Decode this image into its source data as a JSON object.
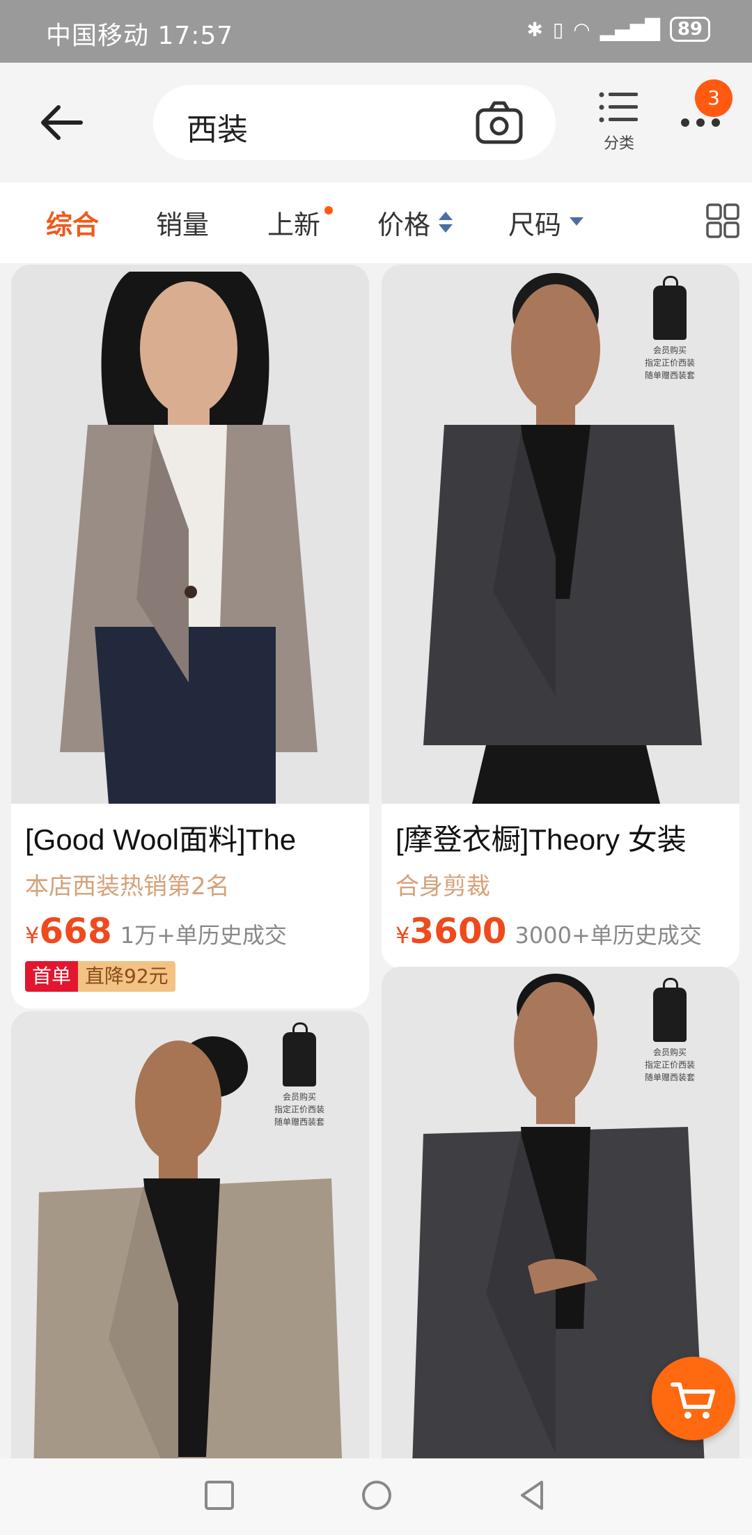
{
  "status_bar": {
    "carrier": "中国移动",
    "time": "17:57",
    "battery": "89"
  },
  "header": {
    "search_query": "西装",
    "category_label": "分类",
    "cart_badge": "3"
  },
  "sort_tabs": [
    {
      "label": "综合",
      "active": true
    },
    {
      "label": "销量"
    },
    {
      "label": "上新"
    },
    {
      "label": "价格"
    },
    {
      "label": "尺码"
    }
  ],
  "products": [
    {
      "title": "[Good Wool面料]The",
      "tag": "本店西装热销第2名",
      "currency": "¥",
      "price": "668",
      "sales": "1万+单历史成交",
      "promo_left": "首单",
      "promo_right": "直降92元"
    },
    {
      "title": "[摩登衣橱]Theory 女装",
      "tag": "合身剪裁",
      "currency": "¥",
      "price": "3600",
      "sales": "3000+单历史成交",
      "stamp": [
        "会员购买",
        "指定正价西装",
        "随单赠西装套"
      ]
    },
    {
      "stamp": [
        "会员购买",
        "指定正价西装",
        "随单赠西装套"
      ]
    },
    {
      "stamp": [
        "会员购买",
        "指定正价西装",
        "随单赠西装套"
      ]
    }
  ],
  "colors": {
    "accent": "#ee5a1d",
    "price": "#ee4a1d",
    "tag": "#d4a27a",
    "fab": "#ff6a10"
  }
}
